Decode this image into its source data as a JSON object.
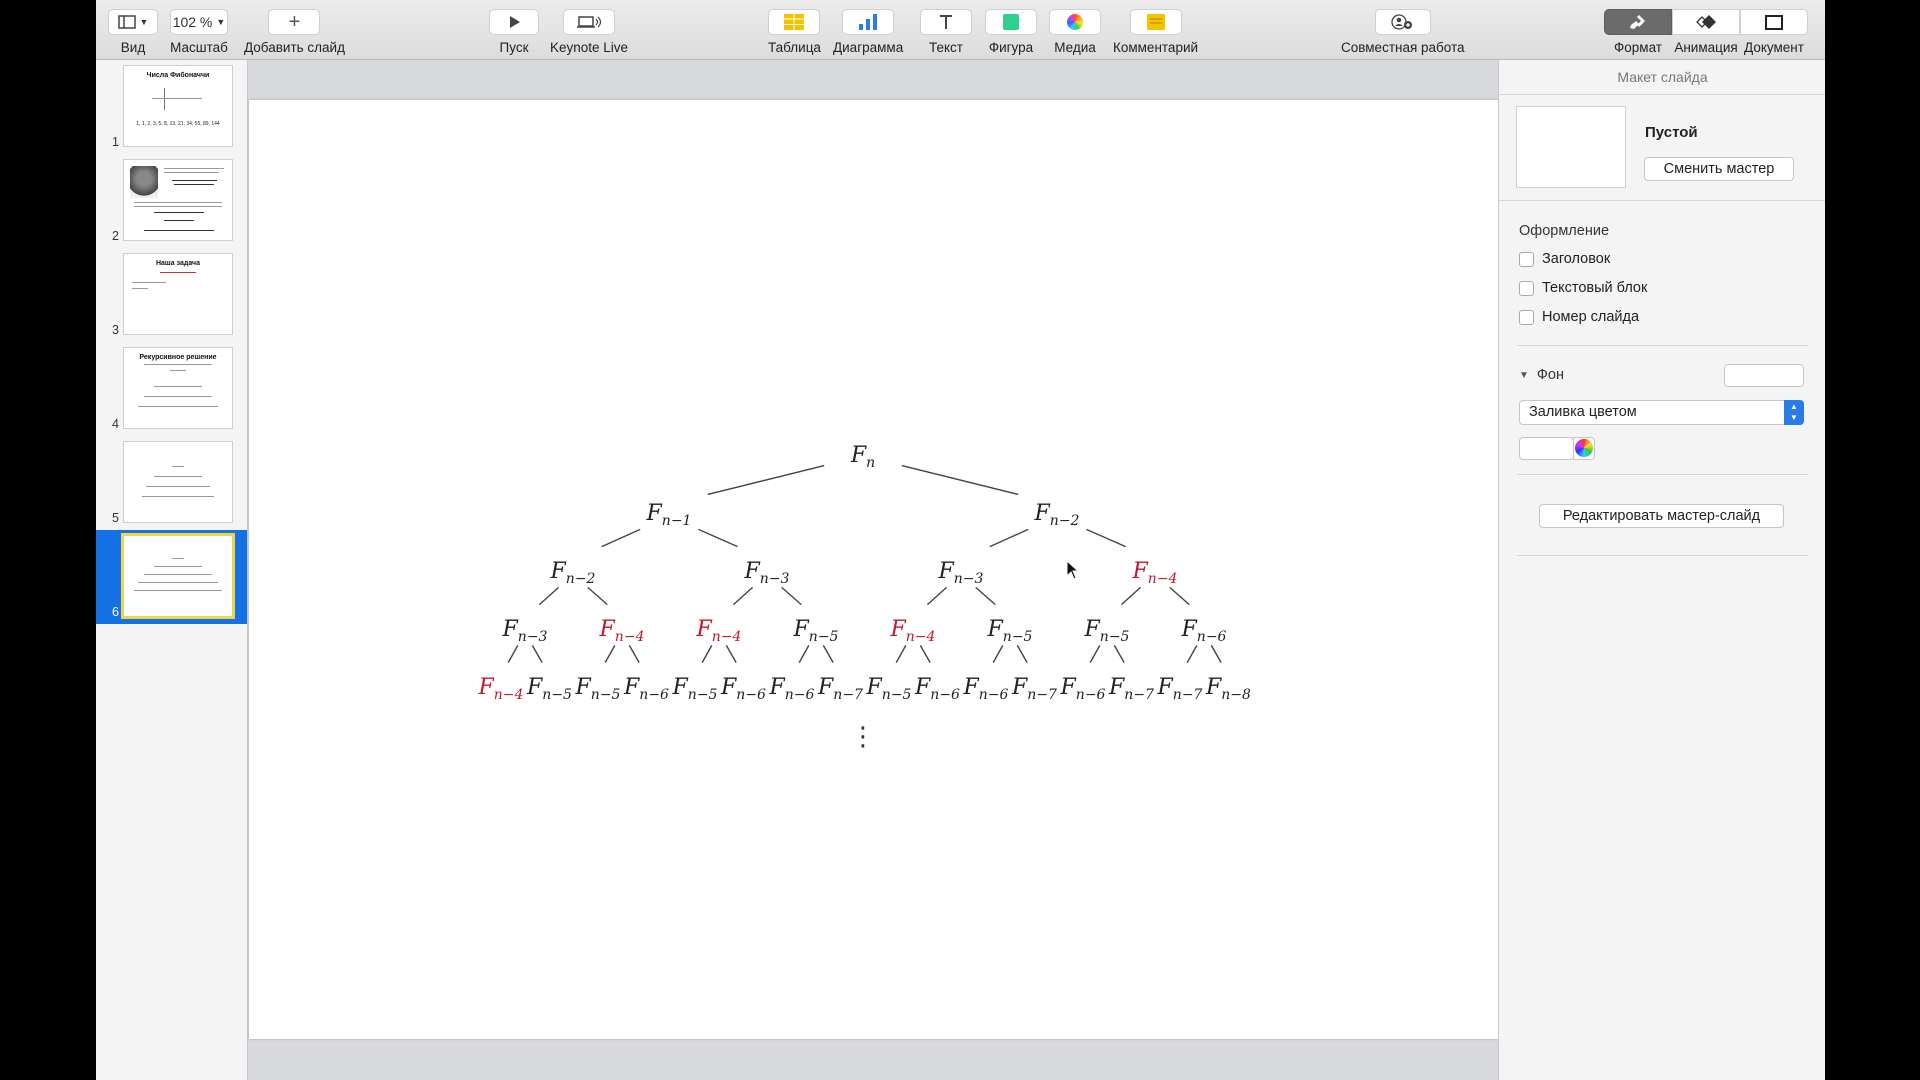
{
  "toolbar": {
    "view_label": "Вид",
    "zoom_value": "102 %",
    "zoom_label": "Масштаб",
    "add_slide_label": "Добавить слайд",
    "play_label": "Пуск",
    "keynote_live_label": "Keynote Live",
    "table_label": "Таблица",
    "chart_label": "Диаграмма",
    "text_label": "Текст",
    "shape_label": "Фигура",
    "media_label": "Медиа",
    "comment_label": "Комментарий",
    "collaborate_label": "Совместная работа",
    "format_label": "Формат",
    "animate_label": "Анимация",
    "document_label": "Документ"
  },
  "navigator": {
    "slides": [
      {
        "num": "1",
        "title": "Числа Фибоначчи",
        "caption": "1, 1, 2, 3, 5, 8, 13, 21, 34, 55, 89, 144"
      },
      {
        "num": "2",
        "title": ""
      },
      {
        "num": "3",
        "title": "Наша задача"
      },
      {
        "num": "4",
        "title": "Рекурсивное решение"
      },
      {
        "num": "5",
        "title": ""
      },
      {
        "num": "6",
        "title": ""
      }
    ]
  },
  "slide": {
    "tree": {
      "root": "n",
      "level1": [
        "n−1",
        "n−2"
      ],
      "level2": [
        "n−2",
        "n−3",
        "n−3",
        "n−4"
      ],
      "level3": [
        "n−3",
        "n−4",
        "n−4",
        "n−5",
        "n−4",
        "n−5",
        "n−5",
        "n−6"
      ],
      "level4": [
        "n−4",
        "n−5",
        "n−5",
        "n−6",
        "n−5",
        "n−6",
        "n−6",
        "n−7",
        "n−5",
        "n−6",
        "n−6",
        "n−7",
        "n−6",
        "n−7",
        "n−7",
        "n−8"
      ],
      "ellipsis": "⋮",
      "highlight_color": "#c0182f"
    }
  },
  "inspector": {
    "header": "Макет слайда",
    "master_name": "Пустой",
    "change_master": "Сменить мастер",
    "appearance_title": "Оформление",
    "checkbox_title": "Заголовок",
    "checkbox_body": "Текстовый блок",
    "checkbox_slide_number": "Номер слайда",
    "background_title": "Фон",
    "fill_option": "Заливка цветом",
    "edit_master": "Редактировать мастер-слайд"
  }
}
